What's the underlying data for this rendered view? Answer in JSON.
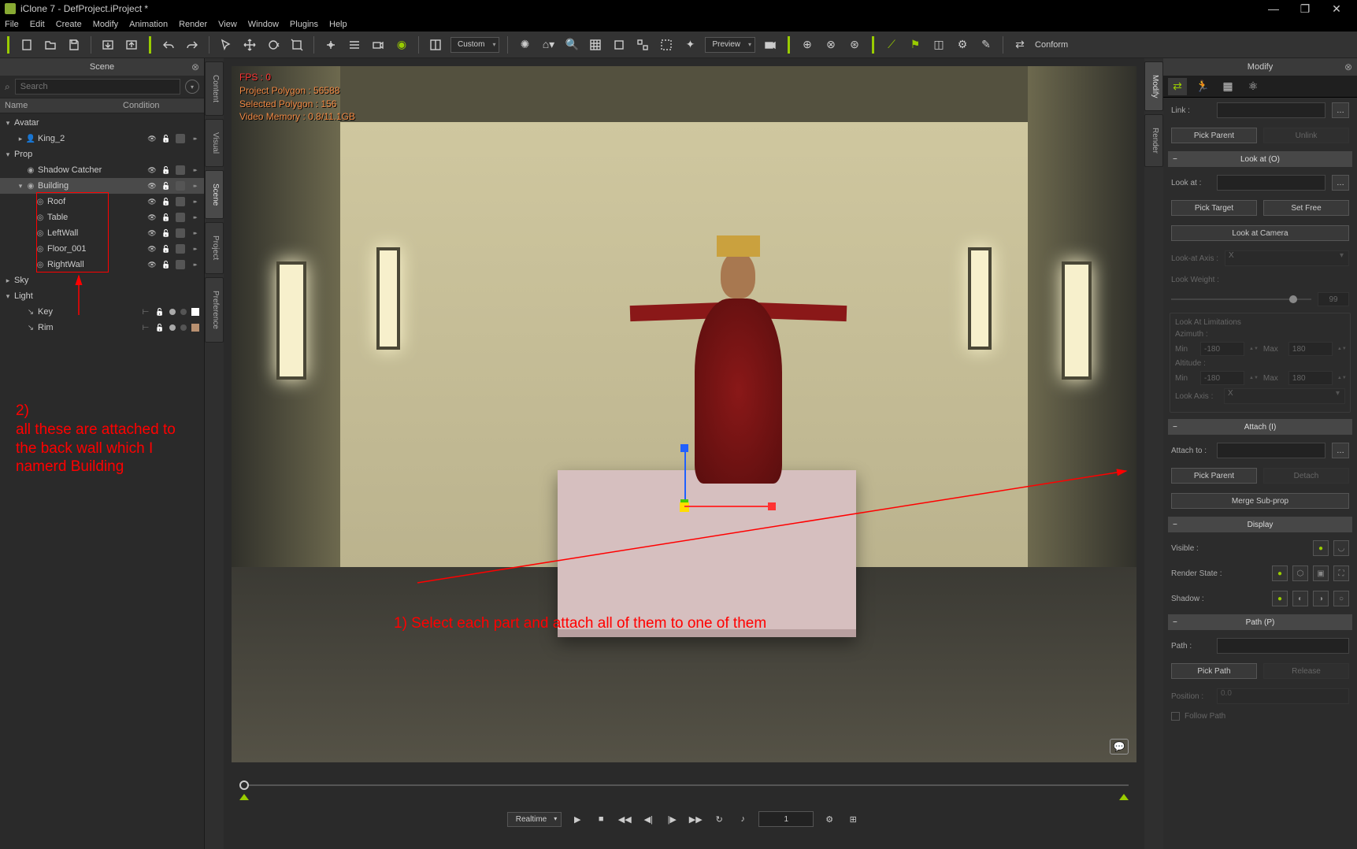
{
  "window": {
    "title": "iClone 7 - DefProject.iProject *"
  },
  "menubar": [
    "File",
    "Edit",
    "Create",
    "Modify",
    "Animation",
    "Render",
    "View",
    "Window",
    "Plugins",
    "Help"
  ],
  "toolbar": {
    "custom": "Custom",
    "preview": "Preview",
    "conform": "Conform"
  },
  "scene": {
    "title": "Scene",
    "search_placeholder": "Search",
    "header_name": "Name",
    "header_cond": "Condition",
    "tree": {
      "avatar": "Avatar",
      "king": "King_2",
      "prop": "Prop",
      "shadow": "Shadow Catcher",
      "building": "Building",
      "roof": "Roof",
      "table": "Table",
      "leftwall": "LeftWall",
      "floor": "Floor_001",
      "rightwall": "RightWall",
      "sky": "Sky",
      "light": "Light",
      "key": "Key",
      "rim": "Rim"
    }
  },
  "side_tabs": {
    "content": "Content",
    "visual": "Visual",
    "scene": "Scene",
    "project": "Project",
    "preference": "Preference"
  },
  "right_tabs": {
    "modify": "Modify",
    "render": "Render"
  },
  "viewport": {
    "fps": "FPS : 0",
    "poly": "Project Polygon : 56588",
    "sel": "Selected Polygon : 156",
    "mem": "Video Memory : 0.8/11.1GB"
  },
  "timeline": {
    "mode": "Realtime",
    "frame": "1"
  },
  "modify": {
    "title": "Modify",
    "link": "Link :",
    "pick_parent": "Pick Parent",
    "unlink": "Unlink",
    "lookat_section": "Look at  (O)",
    "lookat": "Look at :",
    "pick_target": "Pick Target",
    "set_free": "Set Free",
    "look_camera": "Look at Camera",
    "lookat_axis": "Look-at Axis :",
    "axis_x": "X",
    "look_weight": "Look Weight :",
    "weight": "99",
    "limitations": "Look At Limitations",
    "azimuth": "Azimuth :",
    "min": "Min",
    "max": "Max",
    "n180": "-180",
    "p180": "180",
    "altitude": "Altitude :",
    "look_axis": "Look Axis :",
    "attach_section": "Attach  (I)",
    "attach_to": "Attach to :",
    "detach": "Detach",
    "merge": "Merge Sub-prop",
    "display_section": "Display",
    "visible": "Visible :",
    "render_state": "Render State :",
    "shadow": "Shadow :",
    "path_section": "Path  (P)",
    "path": "Path :",
    "pick_path": "Pick Path",
    "release": "Release",
    "position": "Position :",
    "pos_val": "0.0",
    "follow": "Follow Path"
  },
  "annotations": {
    "a1": "1) Select each part and attach all of them to one of them",
    "a2_l1": "2)",
    "a2_l2": "all these are attached to",
    "a2_l3": "the back wall which I",
    "a2_l4": "namerd Building"
  }
}
